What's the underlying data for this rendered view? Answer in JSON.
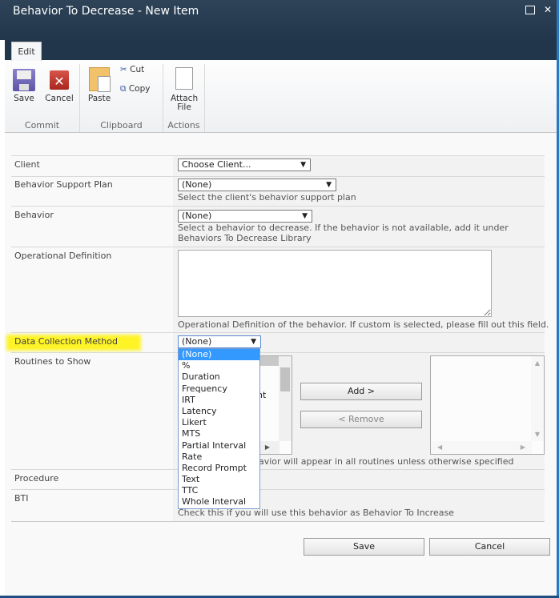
{
  "window": {
    "title": "Behavior To Decrease - New Item",
    "maximize_icon": "maximize-icon",
    "close_icon": "close-icon"
  },
  "ribbon": {
    "tab": "Edit",
    "groups": [
      {
        "label": "Commit",
        "buttons": [
          {
            "label": "Save",
            "icon": "floppy-disk-icon"
          },
          {
            "label": "Cancel",
            "icon": "cancel-x-icon"
          }
        ]
      },
      {
        "label": "Clipboard",
        "buttons": [
          {
            "label": "Paste",
            "icon": "clipboard-icon"
          },
          {
            "label": "Cut",
            "icon": "scissors-icon"
          },
          {
            "label": "Copy",
            "icon": "copy-icon"
          }
        ]
      },
      {
        "label": "Actions",
        "buttons": [
          {
            "label": "Attach File",
            "icon": "paperclip-document-icon"
          }
        ]
      }
    ]
  },
  "form": {
    "client": {
      "label": "Client",
      "value": "Choose Client..."
    },
    "bsp": {
      "label": "Behavior Support Plan",
      "value": "(None)",
      "help": "Select the client's behavior support plan"
    },
    "behavior": {
      "label": "Behavior",
      "value": "(None)",
      "help1": "Select a behavior to decrease. If the behavior is not available, add it under",
      "help2": "Behaviors To Decrease Library"
    },
    "opdef": {
      "label": "Operational Definition",
      "value": "",
      "help": "Operational Definition of the behavior. If custom is selected, please fill out this field."
    },
    "dcm": {
      "label": "Data Collection Method",
      "value": "(None)",
      "options": [
        "(None)",
        "%",
        "Duration",
        "Frequency",
        "IRT",
        "Latency",
        "Likert",
        "MTS",
        "Partial Interval",
        "Rate",
        "Record Prompt",
        "Text",
        "TTC",
        "Whole Interval"
      ],
      "selected": "(None)"
    },
    "routines": {
      "label": "Routines to Show",
      "add": "Add >",
      "remove": "< Remove",
      "help_visible": "avior will appear in all routines unless otherwise specified",
      "partial_item_visible": "nt"
    },
    "procedure": {
      "label": "Procedure"
    },
    "bti": {
      "label": "BTI",
      "help": "Check this if you will use this behavior as Behavior To Increase"
    }
  },
  "footer": {
    "save": "Save",
    "cancel": "Cancel"
  },
  "colors": {
    "titlebar": "#21364a",
    "highlight": "#fff200",
    "selected_option": "#3399ff"
  }
}
